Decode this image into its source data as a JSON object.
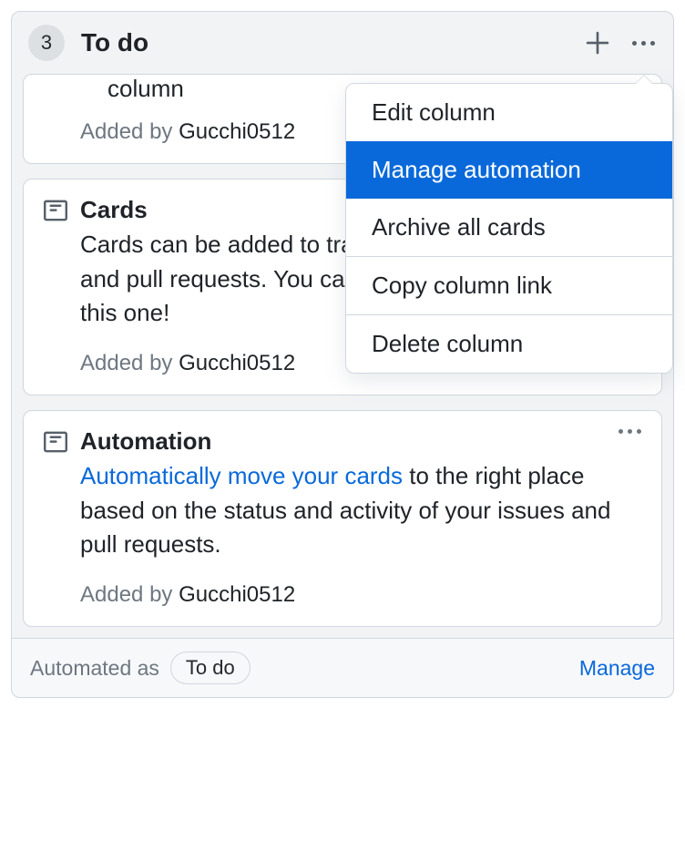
{
  "column": {
    "count": "3",
    "title": "To do",
    "menu": {
      "edit": "Edit column",
      "manage_automation": "Manage automation",
      "archive_all": "Archive all cards",
      "copy_link": "Copy column link",
      "delete": "Delete column"
    }
  },
  "cards": {
    "card0": {
      "partial_line": "column",
      "added_by_prefix": "Added by ",
      "author": "Gucchi0512"
    },
    "card1": {
      "title": "Cards",
      "body": "Cards can be added to track the progress of issues and pull requests. You can also add note cards, like this one!",
      "added_by_prefix": "Added by ",
      "author": "Gucchi0512"
    },
    "card2": {
      "title": "Automation",
      "link_text": "Automatically move your cards",
      "body_rest": " to the right place based on the status and activity of your issues and pull requests.",
      "added_by_prefix": "Added by ",
      "author": "Gucchi0512"
    }
  },
  "footer": {
    "automated_as": "Automated as",
    "badge": "To do",
    "manage": "Manage"
  }
}
